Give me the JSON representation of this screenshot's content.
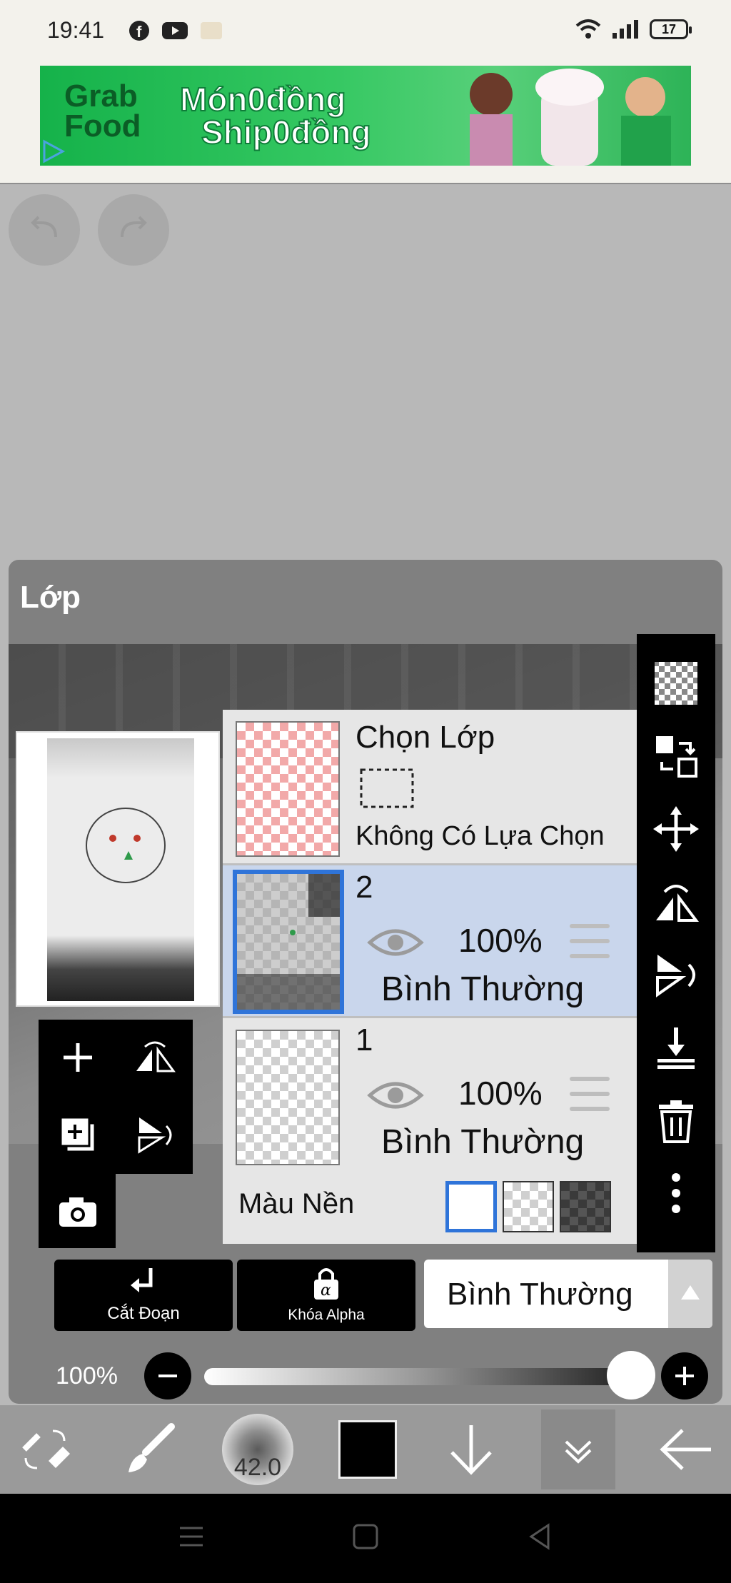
{
  "status": {
    "time": "19:41",
    "battery": "17"
  },
  "ad": {
    "brand_line1": "Grab",
    "brand_line2": "Food",
    "slogan_line1": "Món0đồng",
    "slogan_line2": "Ship0đồng"
  },
  "panel": {
    "title": "Lớp",
    "selection": {
      "title": "Chọn Lớp",
      "subtitle": "Không Có Lựa Chọn"
    },
    "layers": [
      {
        "name": "2",
        "opacity": "100%",
        "blend": "Bình Thường",
        "selected": true
      },
      {
        "name": "1",
        "opacity": "100%",
        "blend": "Bình Thường",
        "selected": false
      }
    ],
    "background_label": "Màu Nền",
    "actions": {
      "clip": "Cắt Đoạn",
      "alpha_lock": "Khóa Alpha"
    },
    "blend_mode": "Bình Thường",
    "opacity_value": "100%"
  },
  "toolbar": {
    "brush_size": "42.0",
    "color": "#000000"
  },
  "colors": {
    "selected_layer": "#c9d6ec",
    "accent": "#2f74d9"
  }
}
